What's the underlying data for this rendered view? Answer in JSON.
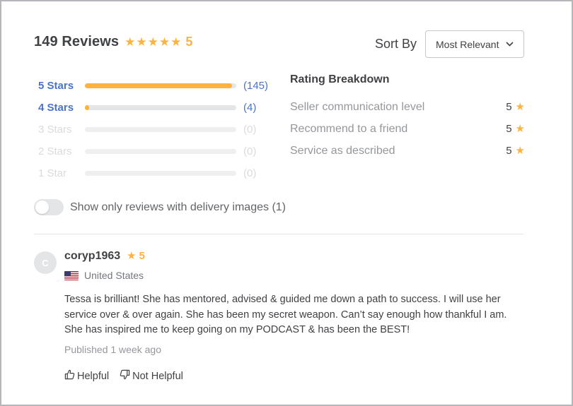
{
  "summary": {
    "reviews_count": "149 Reviews",
    "overall_rating": "5",
    "stars": [
      "★",
      "★",
      "★",
      "★",
      "★"
    ]
  },
  "sort": {
    "label": "Sort By",
    "selected": "Most Relevant",
    "chevron": "⌄"
  },
  "star_breakdown": [
    {
      "label": "5 Stars",
      "count_text": "(145)",
      "fraction": 0.973,
      "active": true
    },
    {
      "label": "4 Stars",
      "count_text": "(4)",
      "fraction": 0.027,
      "active": true
    },
    {
      "label": "3 Stars",
      "count_text": "(0)",
      "fraction": 0,
      "active": false
    },
    {
      "label": "2 Stars",
      "count_text": "(0)",
      "fraction": 0,
      "active": false
    },
    {
      "label": "1 Star",
      "count_text": "(0)",
      "fraction": 0,
      "active": false
    }
  ],
  "rating_breakdown": {
    "title": "Rating Breakdown",
    "items": [
      {
        "label": "Seller communication level",
        "value": "5"
      },
      {
        "label": "Recommend to a friend",
        "value": "5"
      },
      {
        "label": "Service as described",
        "value": "5"
      }
    ]
  },
  "filter_toggle": {
    "label": "Show only reviews with delivery images (1)",
    "on": false
  },
  "review": {
    "avatar_initial": "C",
    "username": "coryp1963",
    "rating": "5",
    "country": "United States",
    "flag_icon": "us-flag-icon",
    "text": "Tessa is brilliant! She has mentored, advised & guided me down a path to success. I will use her service over & over again. She has been my secret weapon. Can’t say enough how thankful I am. She has inspired me to keep going on my PODCAST & has been the BEST!",
    "published": "Published 1 week ago",
    "helpful_label": "Helpful",
    "not_helpful_label": "Not Helpful"
  },
  "colors": {
    "star": "#ffb33e",
    "link": "#4a73c8",
    "text": "#404145",
    "muted": "#95979d"
  }
}
